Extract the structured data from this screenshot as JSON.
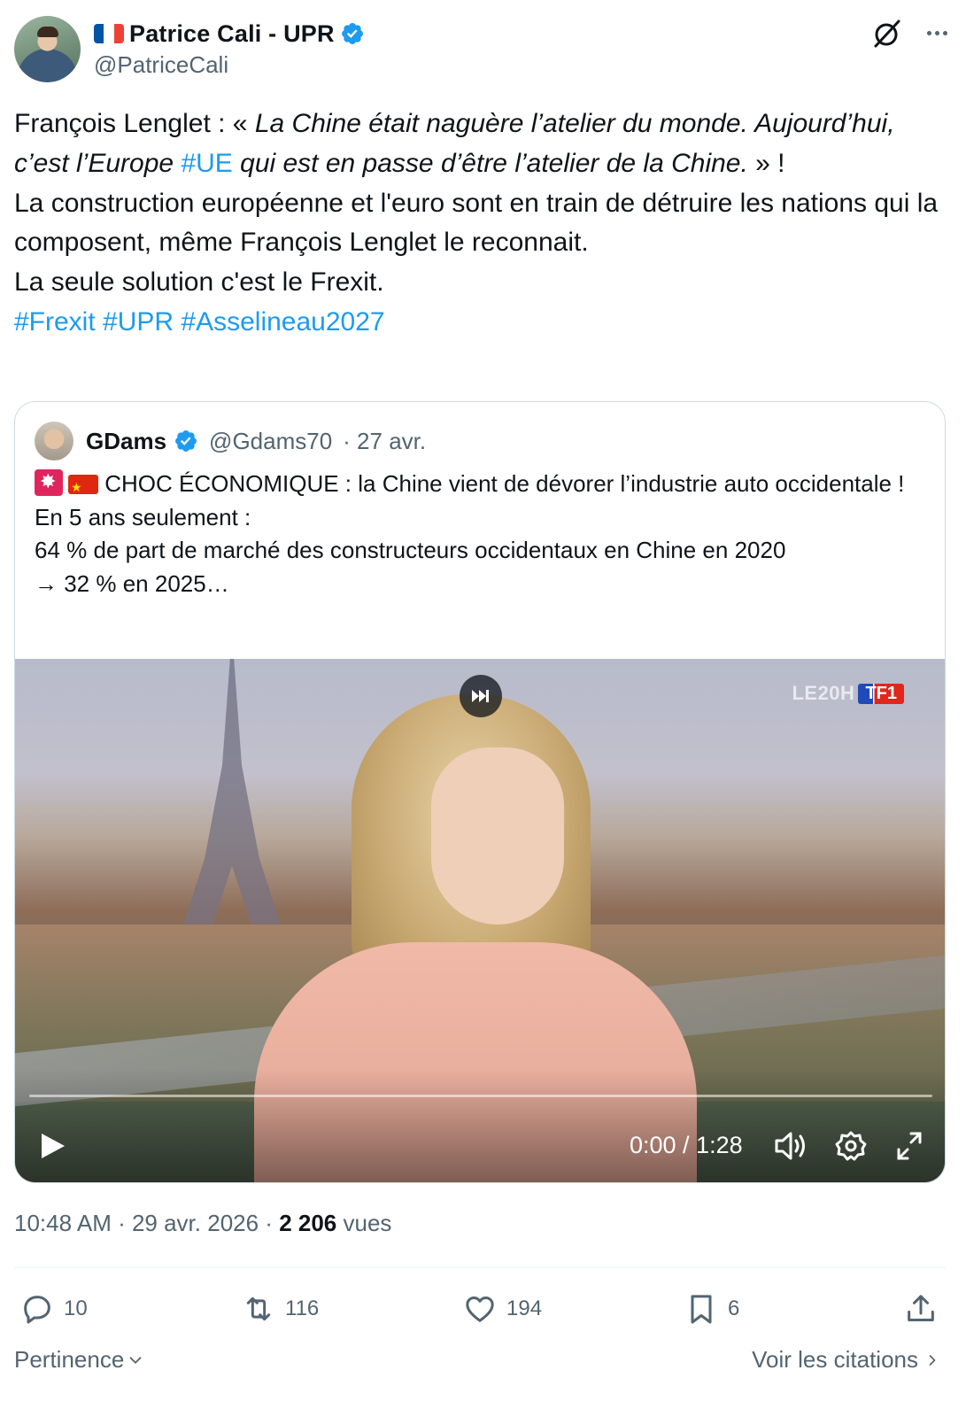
{
  "author": {
    "display_name": "Patrice Cali - UPR",
    "handle": "@PatriceCali",
    "flag_icon": "flag-france",
    "verified_color": "#1d9bf0"
  },
  "tweet": {
    "segments": [
      {
        "text": "François Lenglet : « ",
        "style": "normal"
      },
      {
        "text": "La Chine était naguère l’atelier du monde. Aujourd’hui, c’est l’Europe ",
        "style": "italic"
      },
      {
        "text": "#UE",
        "style": "tag"
      },
      {
        "text": " qui est en passe d’être l’atelier de la Chine.",
        "style": "italic"
      },
      {
        "text": " » !",
        "style": "normal"
      },
      {
        "text": "\nLa construction européenne et l'euro sont en train de détruire les nations qui la composent, même François Lenglet le reconnait.\nLa seule solution c'est le Frexit.\n",
        "style": "normal"
      },
      {
        "text": "#Frexit",
        "style": "tag"
      },
      {
        "text": " ",
        "style": "normal"
      },
      {
        "text": "#UPR",
        "style": "tag"
      },
      {
        "text": " ",
        "style": "normal"
      },
      {
        "text": "#Asselineau2027",
        "style": "tag"
      }
    ],
    "timestamp": "10:48 AM · 29 avr. 2026 · ",
    "views_count": "2 206",
    "views_label": " vues"
  },
  "quoted": {
    "display_name": "GDams",
    "handle": "@Gdams70",
    "date": "· 27 avr.",
    "emoji_icons": [
      "siren-emoji",
      "china-flag-emoji"
    ],
    "line1": "CHOC ÉCONOMIQUE : la Chine vient de dévorer l’industrie auto occidentale !",
    "line2": "En 5 ans seulement :",
    "line3": "64 % de part de marché des constructeurs occidentaux en Chine en 2020",
    "line4": "→ 32 % en 2025…",
    "video": {
      "channel_logo_left": "LE20H",
      "channel_logo_right": "TF1",
      "time_display": "0:00 / 1:28",
      "progress": 0
    }
  },
  "actions": {
    "replies": "10",
    "reposts": "116",
    "likes": "194",
    "bookmarks": "6"
  },
  "footer": {
    "sort_label": "Pertinence",
    "quotes_link": "Voir les citations"
  },
  "colors": {
    "accent": "#1d9bf0",
    "secondary_text": "#536471",
    "primary_text": "#0f1419"
  }
}
